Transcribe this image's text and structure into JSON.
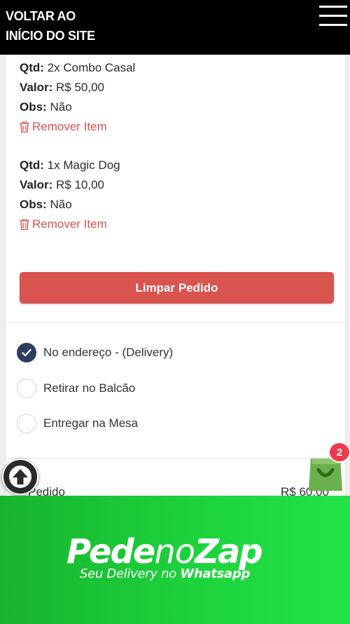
{
  "header": {
    "back_line1": "VOLTAR AO",
    "back_line2": "INÍCIO DO SITE"
  },
  "cart_items": [
    {
      "qtd_label": "Qtd:",
      "qtd_value": "2x Combo Casal",
      "valor_label": "Valor:",
      "valor_value": "R$ 50,00",
      "obs_label": "Obs:",
      "obs_value": "Não",
      "remove_label": "Remover Item"
    },
    {
      "qtd_label": "Qtd:",
      "qtd_value": "1x Magic Dog",
      "valor_label": "Valor:",
      "valor_value": "R$ 10,00",
      "obs_label": "Obs:",
      "obs_value": "Não",
      "remove_label": "Remover Item"
    }
  ],
  "clear_button_label": "Limpar Pedido",
  "delivery_options": [
    {
      "label": "No endereço - (Delivery)",
      "checked": true
    },
    {
      "label": "Retirar no Balcão",
      "checked": false
    },
    {
      "label": "Entregar na Mesa",
      "checked": false
    }
  ],
  "summary": {
    "label": "Pedido",
    "value": "R$ 60,00"
  },
  "cart_badge_count": "2",
  "banner": {
    "brand_part1": "Pede",
    "brand_part2": "no",
    "brand_part3": "Zap",
    "tagline": "Seu Delivery no",
    "tagline_bold": "Whatsapp"
  },
  "colors": {
    "accent_red": "#d9534f",
    "radio_checked": "#2b3e5c",
    "badge": "#f0384f",
    "banner_green": "#1dd23c"
  },
  "icons": [
    "menu-icon",
    "trash-icon",
    "check-icon",
    "arrow-up-icon",
    "shopping-bag-icon"
  ]
}
